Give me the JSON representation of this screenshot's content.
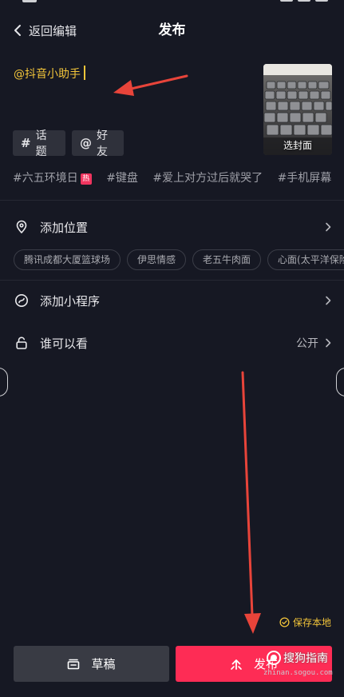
{
  "header": {
    "back_label": "返回编辑",
    "title": "发布"
  },
  "caption": {
    "text": "@抖音小助手"
  },
  "cover": {
    "label": "选封面"
  },
  "chips": {
    "topic": {
      "symbol": "#",
      "label": "话题"
    },
    "friend": {
      "symbol": "@",
      "label": "好友"
    }
  },
  "hashtags": [
    {
      "text": "#六五环境日",
      "badge": "热"
    },
    {
      "text": "#键盘"
    },
    {
      "text": "#爱上对方过后就哭了"
    },
    {
      "text": "#手机屏幕"
    }
  ],
  "location": {
    "label": "添加位置",
    "suggestions": [
      "腾讯成都大厦篮球场",
      "伊思情感",
      "老五牛肉面",
      "心面(太平洋保险"
    ]
  },
  "mini_program": {
    "label": "添加小程序"
  },
  "visibility": {
    "label": "谁可以看",
    "value": "公开"
  },
  "save_local": {
    "label": "保存本地"
  },
  "buttons": {
    "draft": "草稿",
    "publish": "发布"
  },
  "watermark": {
    "main": "搜狗指南",
    "sub": "zhinan.sogou.com"
  },
  "colors": {
    "background": "#161823",
    "accent_yellow": "#f3c53a",
    "publish_red": "#fe2c55",
    "annotation_arrow": "#e8443a"
  }
}
